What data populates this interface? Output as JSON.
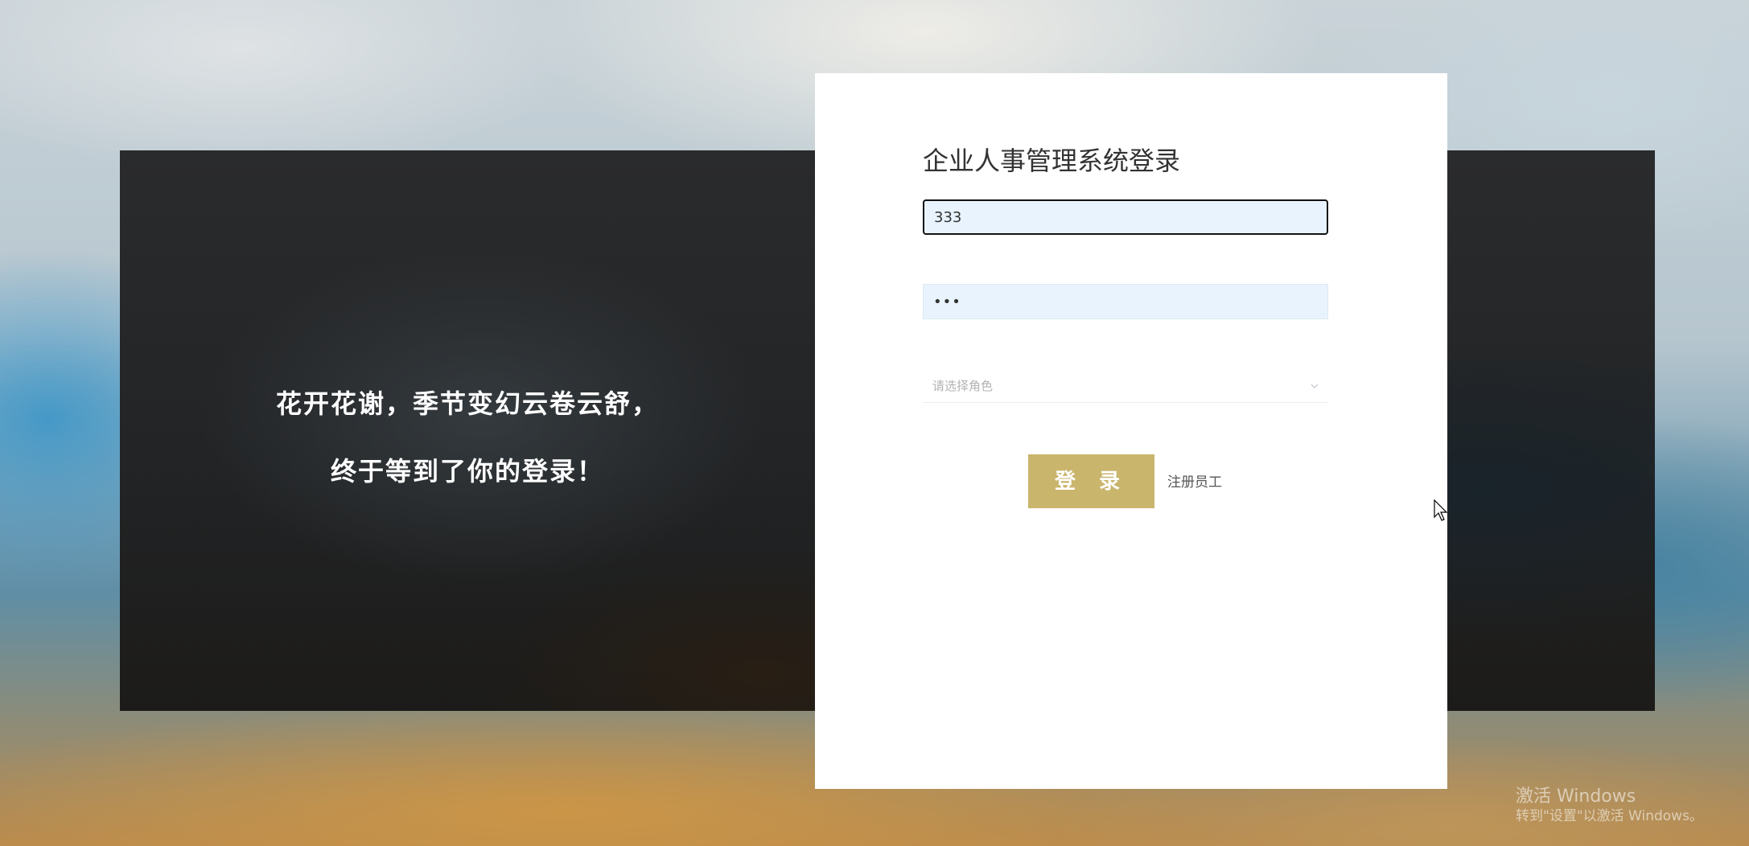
{
  "banner": {
    "slogan_line1": "花开花谢，季节变幻云卷云舒，",
    "slogan_line2": "终于等到了你的登录！"
  },
  "login": {
    "title": "企业人事管理系统登录",
    "username_value": "333",
    "password_value": "•••",
    "role_placeholder": "请选择角色",
    "login_button": "登 录",
    "register_link": "注册员工"
  },
  "watermark": {
    "line1": "激活 Windows",
    "line2": "转到\"设置\"以激活 Windows。"
  },
  "colors": {
    "accent": "#c9b56c",
    "input_bg": "#e8f3fd"
  }
}
